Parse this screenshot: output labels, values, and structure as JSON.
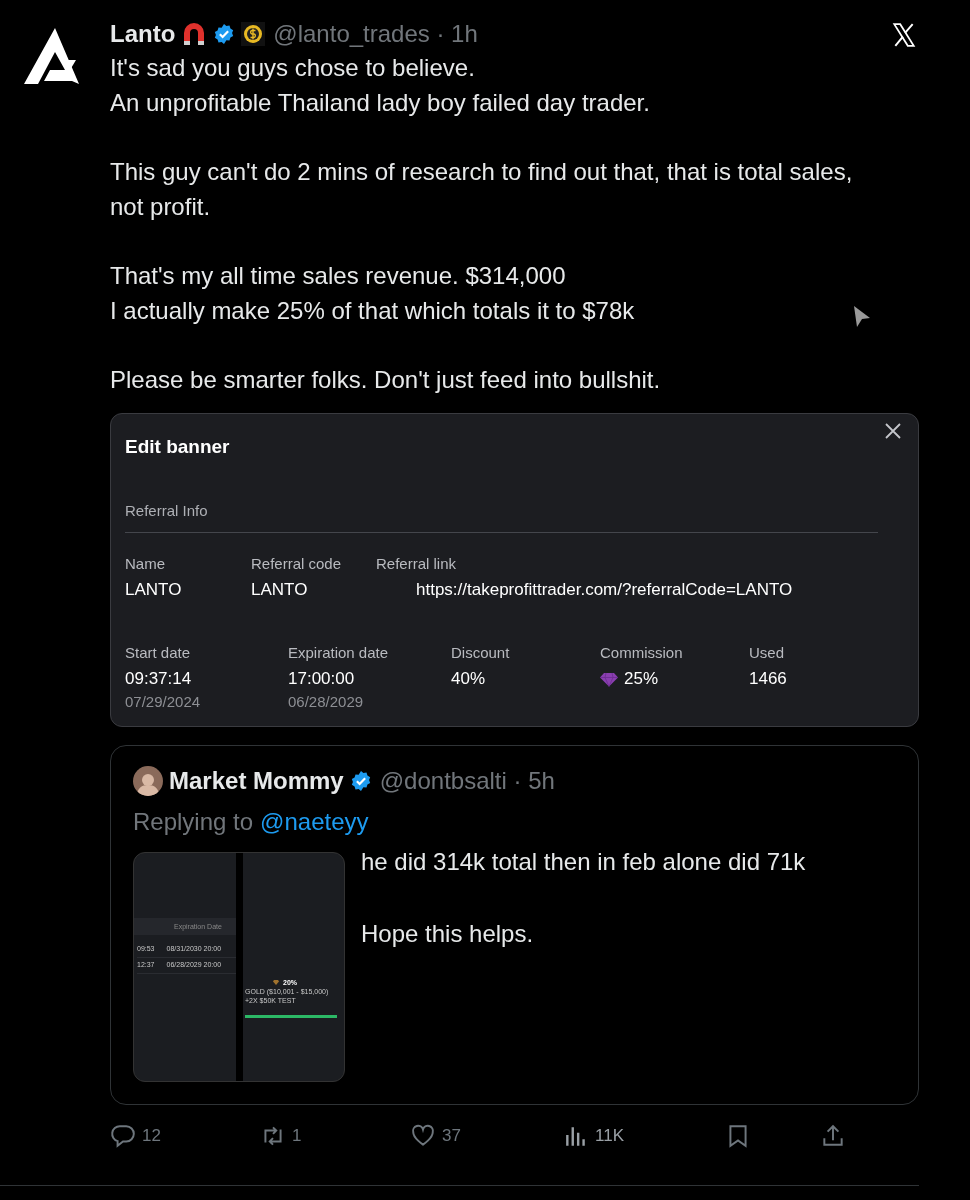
{
  "author": {
    "name": "Lanto",
    "handle": "@lanto_trades · 1h",
    "verified": true
  },
  "paragraphs": [
    [
      "It's sad you guys chose to believe.",
      "An unprofitable Thailand lady boy failed day trader."
    ],
    [
      "This guy can't do 2 mins of research to find out that, that is total sales,",
      "not profit."
    ],
    [
      "That's my all time sales revenue. $314,000",
      "I actually make 25% of that which totals it to $78k"
    ],
    [
      "Please be smarter folks. Don't just feed into bullshit."
    ]
  ],
  "banner": {
    "title": "Edit banner",
    "section": "Referral Info",
    "fields": [
      {
        "label": "Name",
        "value": "LANTO"
      },
      {
        "label": "Referral code",
        "value": "LANTO"
      },
      {
        "label": "Referral link",
        "value": "https://takeprofittrader.com/?referralCode=LANTO"
      }
    ],
    "stats": [
      {
        "kind": "plain",
        "label": "Start date",
        "value": "09:37:14",
        "sub": "07/29/2024"
      },
      {
        "kind": "plain",
        "label": "Expiration date",
        "value": "17:00:00",
        "sub": "06/28/2029"
      },
      {
        "kind": "plain",
        "label": "Discount",
        "value": "40%"
      },
      {
        "kind": "gem",
        "label": "Commission",
        "value": "25%"
      },
      {
        "kind": "plain",
        "label": "Used",
        "value": "1466"
      }
    ]
  },
  "quote": {
    "name": "Market Mommy",
    "handle": "@dontbsalti · 5h",
    "verified": true,
    "reply_prefix": "Replying to",
    "reply_to": "@naeteyy",
    "lines": [
      "he did 314k total then in feb alone did 71k",
      "Hope this helps."
    ],
    "media": {
      "left_rows": [
        [
          "09:53",
          "08/31/2030 20:00"
        ],
        [
          "12:37",
          "06/28/2029 20:00"
        ]
      ],
      "left_header": "Expiration Date",
      "tier_percent": "20%",
      "tier_name": "GOLD ($10,001 - $15,000)",
      "tier_bonus": "+2X $50K TEST"
    }
  },
  "actions": [
    {
      "kind": "reply",
      "count": "12"
    },
    {
      "kind": "repost",
      "count": "1"
    },
    {
      "kind": "like",
      "count": "37"
    },
    {
      "kind": "views",
      "count": "11K"
    },
    {
      "kind": "bookmark"
    },
    {
      "kind": "share"
    }
  ]
}
